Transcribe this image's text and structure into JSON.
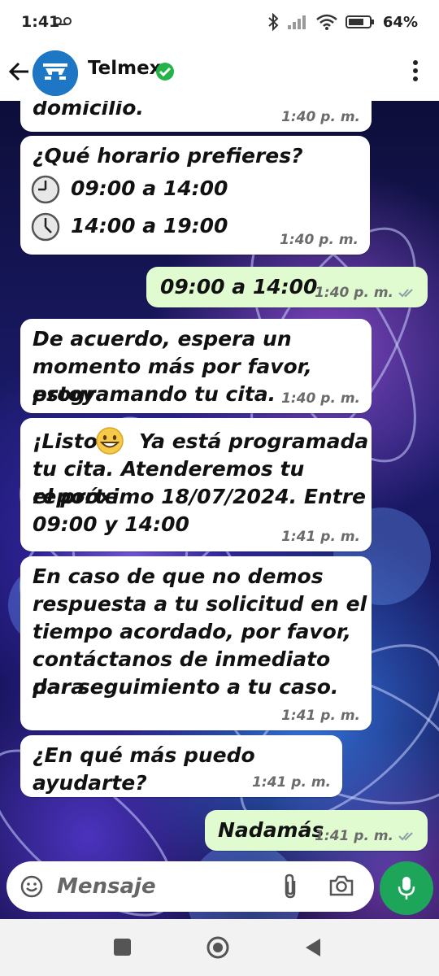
{
  "status_bar": {
    "time": "1:41",
    "battery": "64%"
  },
  "header": {
    "contact_name": "Telmex",
    "verified": true
  },
  "messages": [
    {
      "dir": "in",
      "lines": [
        "domicilio."
      ],
      "time": "1:40 p. m."
    },
    {
      "dir": "in",
      "lines": [
        "¿Qué horario prefieres?",
        "09:00 a 14:00",
        "14:00 a 19:00"
      ],
      "time": "1:40 p. m."
    },
    {
      "dir": "out",
      "lines": [
        "09:00 a 14:00"
      ],
      "time": "1:40 p. m."
    },
    {
      "dir": "in",
      "lines": [
        "De acuerdo, espera un",
        "momento más por favor, estoy",
        "programando tu cita."
      ],
      "time": "1:40 p. m."
    },
    {
      "dir": "in",
      "lines": [
        "¡Listo!",
        "Ya está programada",
        "tu cita. Atenderemos tu reporte",
        "el próximo 18/07/2024. Entre",
        "09:00 y 14:00"
      ],
      "time": "1:41 p. m."
    },
    {
      "dir": "in",
      "lines": [
        "En caso de que no demos",
        "respuesta a tu solicitud en el",
        "tiempo acordado, por favor,",
        "contáctanos de inmediato para",
        "dar seguimiento a tu caso."
      ],
      "time": "1:41 p. m."
    },
    {
      "dir": "in",
      "lines": [
        "¿En qué más puedo ayudarte?"
      ],
      "time": "1:41 p. m."
    },
    {
      "dir": "out",
      "lines": [
        "Nadamás"
      ],
      "time": "1:41 p. m."
    }
  ],
  "input": {
    "placeholder": "Mensaje"
  },
  "icons": {
    "back": "arrow-left-icon",
    "more": "more-vertical-icon",
    "emoji": "emoji-icon",
    "attach": "paperclip-icon",
    "camera": "camera-icon",
    "mic": "microphone-icon",
    "clock": "clock-icon"
  },
  "colors": {
    "outgoing_bubble": "#e0fbcf",
    "incoming_bubble": "#ffffff",
    "mic_button": "#1da65a",
    "verified": "#25b34a",
    "read_ticks": "#8aa0a8"
  }
}
